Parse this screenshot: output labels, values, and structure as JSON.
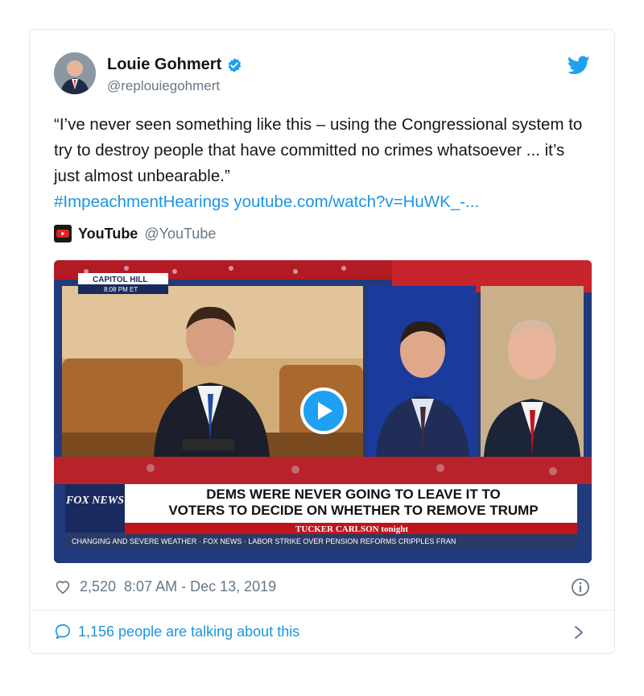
{
  "author": {
    "name": "Louie Gohmert",
    "handle": "@replouiegohmert"
  },
  "tweet": {
    "quote": "“I’ve never seen something like this – using the Congressional system to try to destroy people that have committed no crimes whatsoever ... it’s just almost unbearable.”",
    "hashtag": "#ImpeachmentHearings",
    "link": "youtube.com/watch?v=HuWK_-..."
  },
  "embed": {
    "source_name": "YouTube",
    "source_handle": "@YouTube",
    "video": {
      "location_tag": "CAPITOL HILL",
      "time_tag": "8:08 PM ET",
      "network": "FOX NEWS",
      "headline_line1": "DEMS WERE NEVER GOING TO LEAVE IT TO",
      "headline_line2": "VOTERS TO DECIDE ON WHETHER TO REMOVE TRUMP",
      "show": "TUCKER CARLSON tonight",
      "ticker": "CHANGING AND SEVERE WEATHER · FOX NEWS · LABOR STRIKE OVER PENSION REFORMS CRIPPLES FRAN"
    }
  },
  "footer": {
    "likes": "2,520",
    "timestamp": "8:07 AM - Dec 13, 2019",
    "talking": "1,156 people are talking about this"
  },
  "colors": {
    "accent": "#1b95e0",
    "verified": "#1da1f2",
    "fox_red": "#c0141b",
    "fox_navy": "#1a2a5e"
  },
  "icons": [
    "verified-badge-icon",
    "twitter-bird-icon",
    "youtube-logo-icon",
    "play-icon",
    "heart-icon",
    "info-icon",
    "speech-bubble-icon",
    "chevron-right-icon"
  ]
}
